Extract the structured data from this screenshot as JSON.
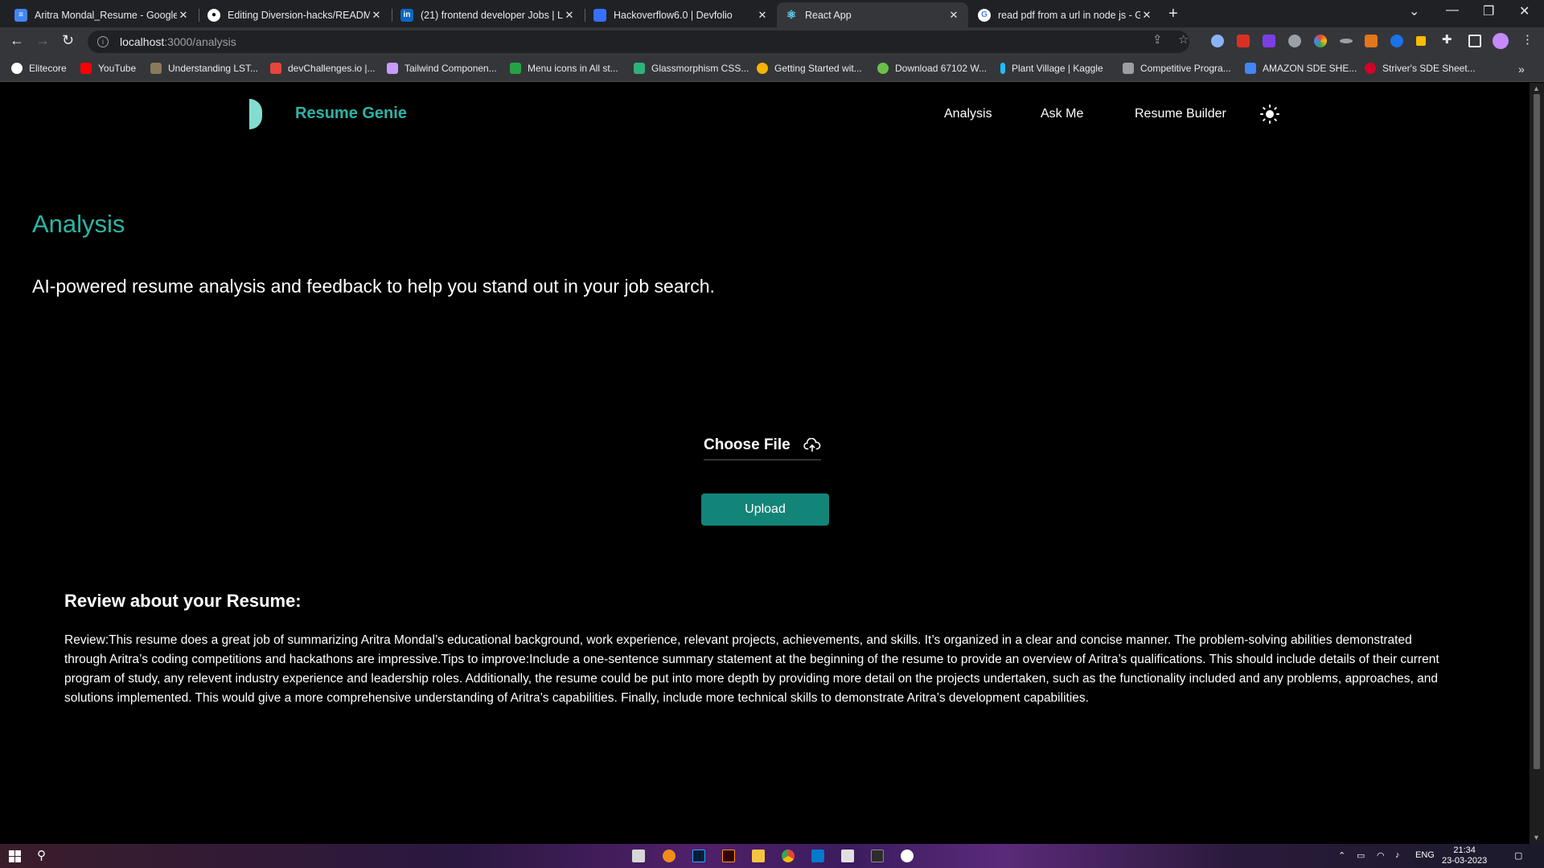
{
  "browser": {
    "tabs": [
      {
        "title": "Aritra Mondal_Resume - Google",
        "icon": "docs-icon",
        "color": "#4285f4"
      },
      {
        "title": "Editing Diversion-hacks/README",
        "icon": "github-icon",
        "color": "#ffffff"
      },
      {
        "title": "(21) frontend developer Jobs | Li",
        "icon": "linkedin-icon",
        "color": "#0a66c2"
      },
      {
        "title": "Hackoverflow6.0 | Devfolio",
        "icon": "devfolio-icon",
        "color": "#3770ff"
      },
      {
        "title": "React App",
        "icon": "react-icon",
        "color": "#61dafb"
      },
      {
        "title": "read pdf from a url in node js - G",
        "icon": "google-icon",
        "color": "#ffffff"
      }
    ],
    "url_host": "localhost",
    "url_path": ":3000/analysis",
    "bookmarks": [
      {
        "label": "Elitecore",
        "color": "#ffffff"
      },
      {
        "label": "YouTube",
        "color": "#ff0000"
      },
      {
        "label": "Understanding LST...",
        "color": "#8a7a5a"
      },
      {
        "label": "devChallenges.io |...",
        "color": "#e8453c"
      },
      {
        "label": "Tailwind Componen...",
        "color": "#c89bff"
      },
      {
        "label": "Menu icons in All st...",
        "color": "#25a244"
      },
      {
        "label": "Glassmorphism CSS...",
        "color": "#2db37a"
      },
      {
        "label": "Getting Started wit...",
        "color": "#f4b400"
      },
      {
        "label": "Download 67102 W...",
        "color": "#6cc04a"
      },
      {
        "label": "Plant Village | Kaggle",
        "color": "#20beff"
      },
      {
        "label": "Competitive Progra...",
        "color": "#9e9e9e"
      },
      {
        "label": "AMAZON SDE SHE...",
        "color": "#4285f4"
      },
      {
        "label": "Striver's SDE Sheet...",
        "color": "#d5002a"
      }
    ]
  },
  "app": {
    "brand": "Resume Genie",
    "nav": {
      "analysis": "Analysis",
      "ask_me": "Ask Me",
      "resume_builder": "Resume Builder"
    },
    "page_title": "Analysis",
    "subtitle": "AI-powered resume analysis and feedback to help you stand out in your job search.",
    "choose_file_label": "Choose File",
    "upload_label": "Upload",
    "review_heading": "Review about your Resume:",
    "review_text": "Review:This resume does a great job of summarizing Aritra Mondal’s educational background, work experience, relevant projects, achievements, and skills. It’s organized in a clear and concise manner. The problem-solving abilities demonstrated through Aritra’s coding competitions and hackathons are impressive.Tips to improve:Include a one-sentence summary statement at the beginning of the resume to provide an overview of Aritra’s qualifications. This should include details of their current program of study, any relevent industry experience and leadership roles. Additionally, the resume could be put into more depth by providing more detail on the projects undertaken, such as the functionality included and any problems, approaches, and solutions implemented. This would give a more comprehensive understanding of Aritra’s capabilities. Finally, include more technical skills to demonstrate Aritra’s development capabilities.",
    "accent_color": "#2cb5a5",
    "button_color": "#138478"
  },
  "taskbar": {
    "language": "ENG",
    "time": "21:34",
    "date": "23-03-2023"
  }
}
